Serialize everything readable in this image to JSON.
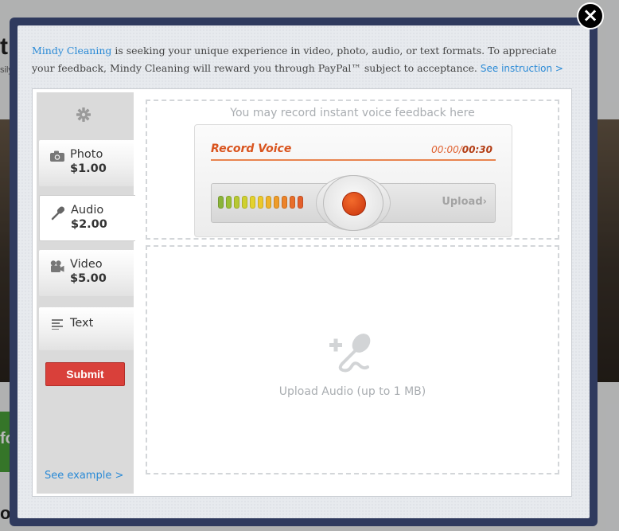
{
  "background": {
    "letter_top": "t",
    "letter_sub": "sily",
    "letter_green": "fo",
    "letter_bottom": "o"
  },
  "modal": {
    "close_label": "×",
    "intro": {
      "brand": "Mindy Cleaning",
      "text": " is seeking your unique experience in video, photo, audio, or text formats. To appreciate your feedback, Mindy Cleaning will reward you through PayPal™ subject to acceptance. ",
      "link": "See instruction >"
    }
  },
  "sidebar": {
    "settings_icon": "gear-icon",
    "tabs": [
      {
        "icon": "camera-icon",
        "label": "Photo",
        "price": "$1.00",
        "active": false
      },
      {
        "icon": "microphone-icon",
        "label": "Audio",
        "price": "$2.00",
        "active": true
      },
      {
        "icon": "video-camera-icon",
        "label": "Video",
        "price": "$5.00",
        "active": false
      },
      {
        "icon": "text-lines-icon",
        "label": "Text",
        "price": "",
        "active": false
      }
    ],
    "submit_label": "Submit",
    "see_example": "See example >"
  },
  "recorder": {
    "hint": "You may record instant voice feedback here",
    "title": "Record Voice",
    "time_current": "00:00/",
    "time_max": "00:30",
    "upload_label": "Upload",
    "upload_chevron": "›",
    "meter_colors": [
      "#8ab43a",
      "#9cc036",
      "#b7c832",
      "#cfd030",
      "#e4d22e",
      "#ecc82c",
      "#eeb42b",
      "#ee9c2a",
      "#ec832a",
      "#e86e2a",
      "#e35f2b"
    ]
  },
  "upload": {
    "icon": "add-microphone-icon",
    "label": "Upload Audio (up to 1 MB)"
  },
  "colors": {
    "accent_link": "#2a8ad6",
    "record_orange": "#d9541e",
    "submit_red": "#d9403a",
    "modal_frame": "#2f3a5e"
  }
}
